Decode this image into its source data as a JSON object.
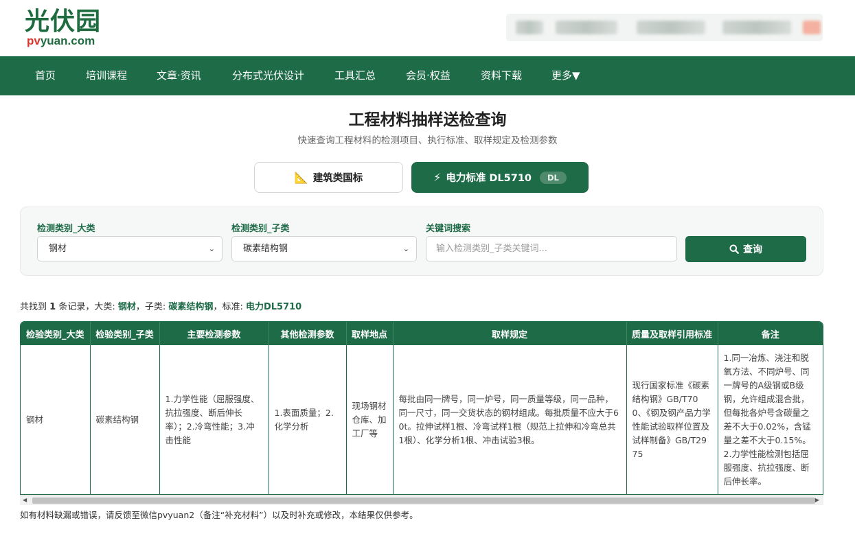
{
  "header": {
    "logo_cn": "光伏园",
    "logo_en_red": "pv",
    "logo_en_green": "yuan.com"
  },
  "nav": {
    "items": [
      "首页",
      "培训课程",
      "文章·资讯",
      "分布式光伏设计",
      "工具汇总",
      "会员·权益",
      "资料下载",
      "更多▼"
    ]
  },
  "page": {
    "title": "工程材料抽样送检查询",
    "subtitle": "快速查询工程材料的检测项目、执行标准、取样规定及检测参数"
  },
  "tabs": {
    "building": {
      "icon": "📐",
      "label": "建筑类国标"
    },
    "power": {
      "icon": "⚡",
      "label": "电力标准 DL5710",
      "badge": "DL"
    }
  },
  "search": {
    "category_label": "检测类别_大类",
    "category_value": "钢材",
    "subcategory_label": "检测类别_子类",
    "subcategory_value": "碳素结构钢",
    "keyword_label": "关键词搜索",
    "keyword_placeholder": "输入检测类别_子类关键词...",
    "keyword_value": "",
    "query_label": "查询"
  },
  "result_info": {
    "prefix": "共找到",
    "count": "1",
    "records_text": "条记录，大类:",
    "category": "钢材",
    "sub_text": "，子类:",
    "subcategory": "碳素结构钢",
    "std_text": "，标准:",
    "standard": "电力DL5710"
  },
  "table": {
    "headers": [
      "检验类别_大类",
      "检验类别_子类",
      "主要检测参数",
      "其他检测参数",
      "取样地点",
      "取样规定",
      "质量及取样引用标准",
      "备注"
    ],
    "rows": [
      [
        "钢材",
        "碳素结构钢",
        "1.力学性能（屈服强度、抗拉强度、断后伸长率）；2.冷弯性能；3.冲击性能",
        "1.表面质量；2.化学分析",
        "现场钢材仓库、加工厂等",
        "每批由同一牌号，同一炉号，同一质量等级，同一品种，同一尺寸，同一交货状态的钢材组成。每批质量不应大于60t。拉伸试样1根、冷弯试样1根（规范上拉伸和冷弯总共1根）、化学分析1根、冲击试验3根。",
        "现行国家标准《碳素结构钢》GB/T700、《钢及钢产品力学性能试验取样位置及试样制备》GB/T2975",
        "1.同一冶炼、浇注和脱氧方法、不同炉号、同一牌号的A级钢或B级钢，允许组成混合批，但每批各炉号含碳量之差不大于0.02%，含锰量之差不大于0.15%。2.力学性能检测包括屈服强度、抗拉强度、断后伸长率。"
      ]
    ]
  },
  "footnote": "如有材料缺漏或错误，请反馈至微信pvyuan2（备注“补充材料”）以及时补充或修改，本结果仅供参考。"
}
